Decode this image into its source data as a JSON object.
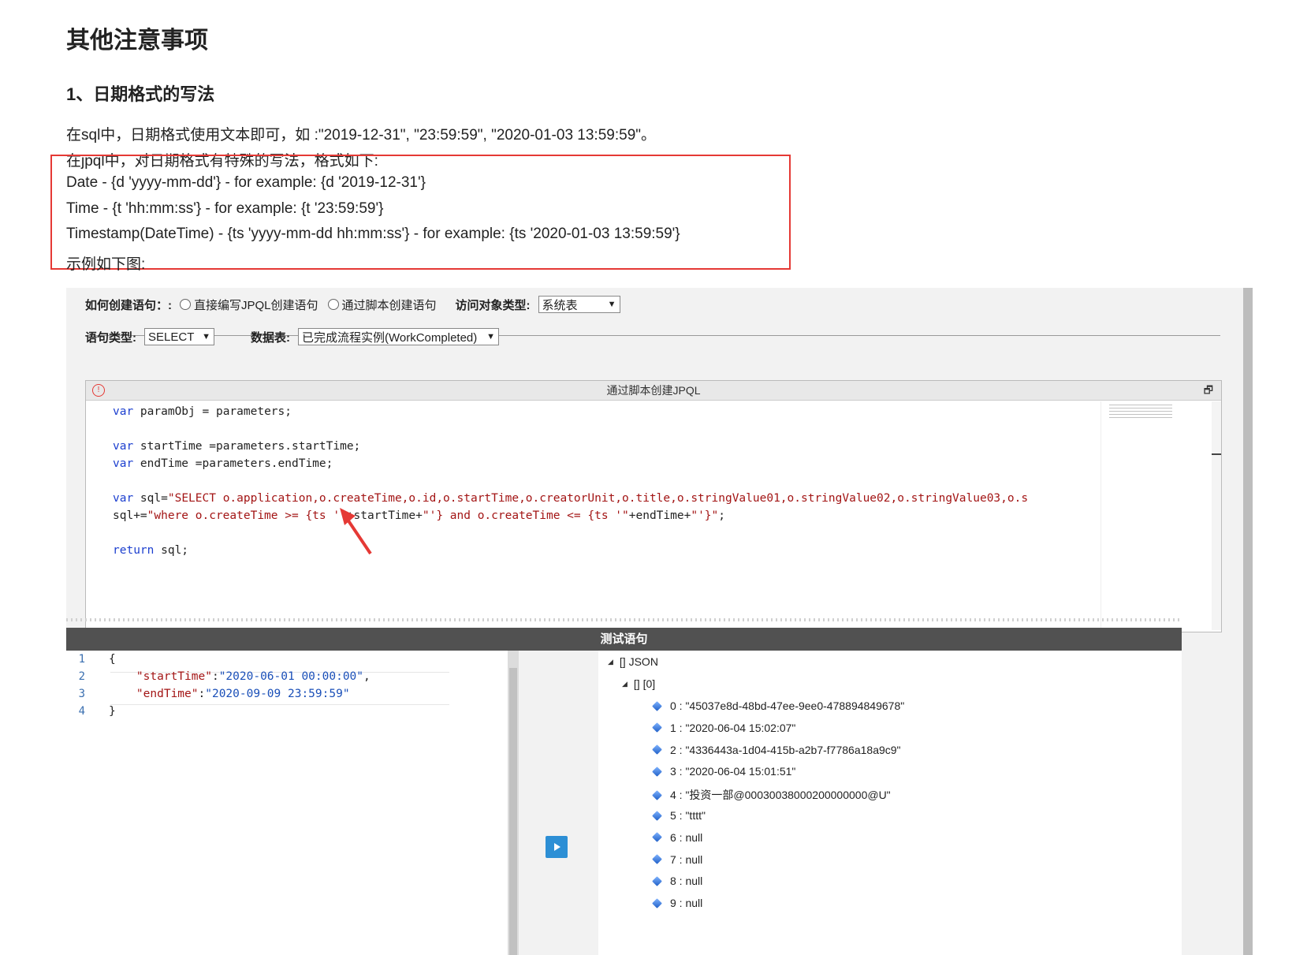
{
  "article": {
    "heading": "其他注意事项",
    "subheading": "1、日期格式的写法",
    "para_sql": "在sql中，日期格式使用文本即可，如 :\"2019-12-31\", \"23:59:59\", \"2020-01-03 13:59:59\"。",
    "para_jpql": "在jpql中，对日期格式有特殊的写法，格式如下:",
    "line_date": "Date - {d 'yyyy-mm-dd'} - for example: {d '2019-12-31'}",
    "line_time": "Time - {t 'hh:mm:ss'} - for example: {t '23:59:59'}",
    "line_ts": "Timestamp(DateTime) - {ts 'yyyy-mm-dd hh:mm:ss'} - for example: {ts '2020-01-03 13:59:59'}",
    "example_caption": "示例如下图:"
  },
  "form": {
    "create_label": "如何创建语句：:",
    "radio_direct": "直接编写JPQL创建语句",
    "radio_script": "通过脚本创建语句",
    "access_type_label": "访问对象类型:",
    "access_type_value": "系统表",
    "stmt_type_label": "语句类型:",
    "stmt_type_value": "SELECT",
    "table_label": "数据表:",
    "table_value": "已完成流程实例(WorkCompleted)"
  },
  "script_editor": {
    "title": "通过脚本创建JPQL",
    "lines": [
      {
        "kw": "var",
        "rest": " paramObj = parameters;"
      },
      {
        "kw": "",
        "rest": ""
      },
      {
        "kw": "var",
        "rest": " startTime =parameters.startTime;"
      },
      {
        "kw": "var",
        "rest": " endTime =parameters.endTime;"
      },
      {
        "kw": "",
        "rest": ""
      },
      {
        "kw": "var",
        "rest": " sql=",
        "str": "\"SELECT o.application,o.createTime,o.id,o.startTime,o.creatorUnit,o.title,o.stringValue01,o.stringValue02,o.stringValue03,o.s"
      },
      {
        "kw": "",
        "rest": "sql+=",
        "str": "\"where o.createTime >= {ts '\"",
        "rest2": "+startTime+",
        "str2": "\"'} and o.createTime <= {ts '\"",
        "rest3": "+endTime+",
        "str3": "\"'}\"",
        "tail": ";"
      },
      {
        "kw": "",
        "rest": ""
      },
      {
        "kw": "return",
        "rest": " sql;"
      }
    ]
  },
  "test_panel": {
    "title": "测试语句",
    "gutter": [
      "1",
      "2",
      "3",
      "4"
    ],
    "json_open": "{",
    "json_close": "}",
    "key1": "\"startTime\"",
    "val1": "\"2020-06-01 00:00:00\"",
    "key2": "\"endTime\"",
    "val2": "\"2020-09-09 23:59:59\""
  },
  "result_tree": {
    "root": "[] JSON",
    "child": "[] [0]",
    "items": [
      "0 : \"45037e8d-48bd-47ee-9ee0-478894849678\"",
      "1 : \"2020-06-04 15:02:07\"",
      "2 : \"4336443a-1d04-415b-a2b7-f7786a18a9c9\"",
      "3 : \"2020-06-04 15:01:51\"",
      "4 : \"投资一部@00030038000200000000@U\"",
      "5 : \"tttt\"",
      "6 : null",
      "7 : null",
      "8 : null",
      "9 : null"
    ]
  },
  "colors": {
    "highlight_box": "#e53935",
    "keyword": "#1c3fcf",
    "string": "#a31515",
    "run_button": "#2d8fd5"
  }
}
